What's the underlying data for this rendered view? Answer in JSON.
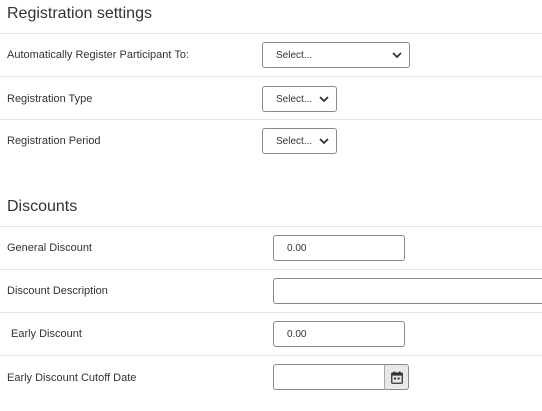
{
  "registration": {
    "title": "Registration settings",
    "rows": [
      {
        "label": "Automatically Register Participant To:",
        "select_value": "Select..."
      },
      {
        "label": "Registration Type",
        "select_value": "Select..."
      },
      {
        "label": "Registration Period",
        "select_value": "Select..."
      }
    ]
  },
  "discounts": {
    "title": "Discounts",
    "general": {
      "label": "General Discount",
      "value": "0.00"
    },
    "description": {
      "label": "Discount Description",
      "value": ""
    },
    "early": {
      "label": "Early Discount",
      "value": "0.00"
    },
    "cutoff": {
      "label": "Early Discount Cutoff Date",
      "value": "",
      "icon": "calendar-icon"
    }
  }
}
